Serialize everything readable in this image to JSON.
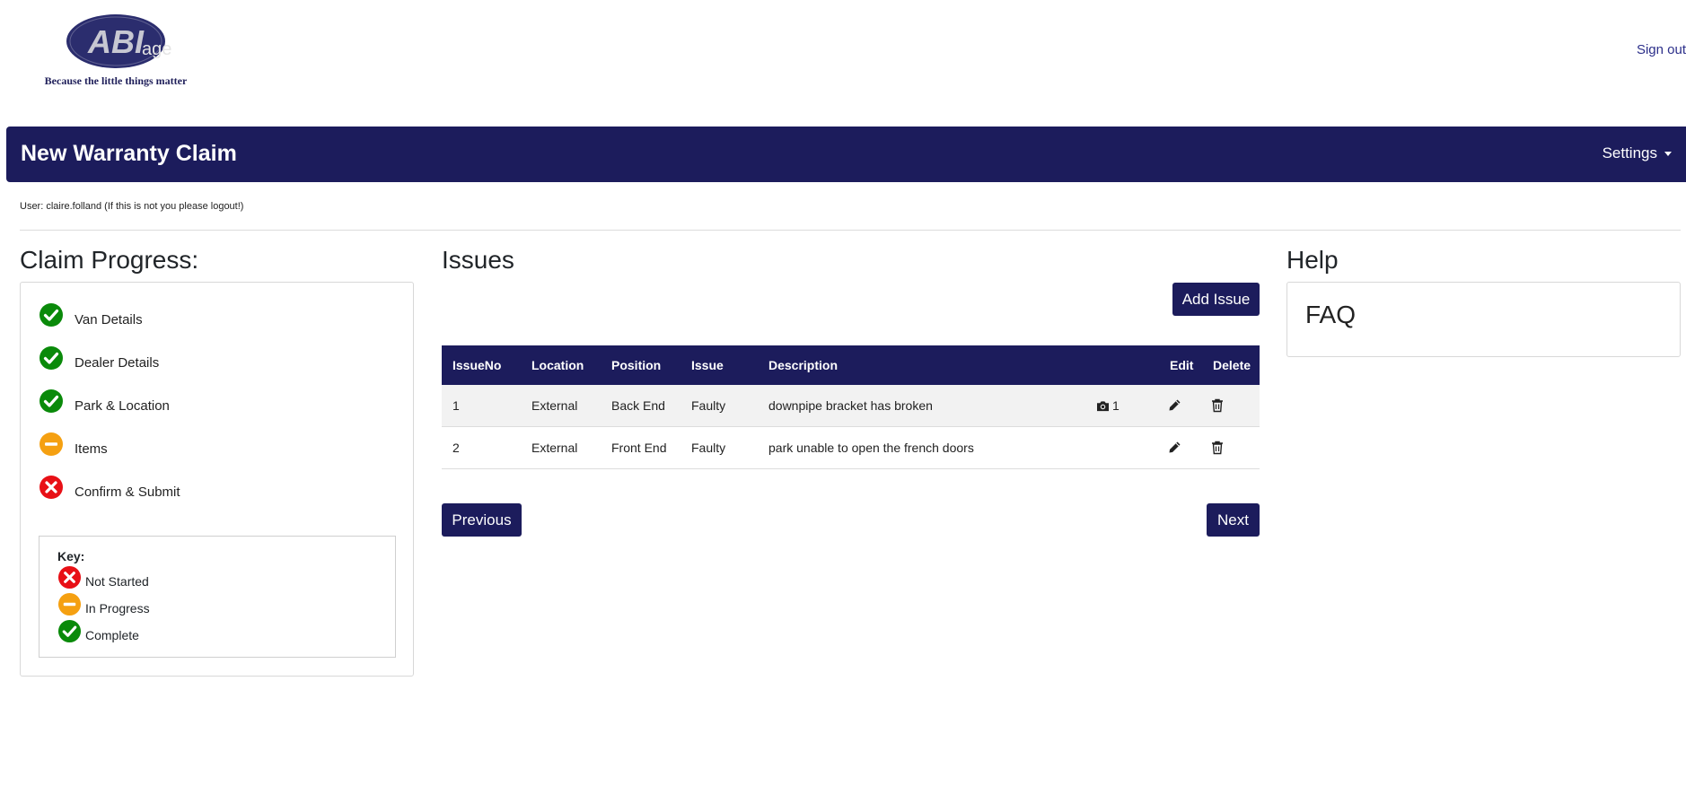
{
  "header": {
    "logo_text": "ABI",
    "tagline": "Because the little things matter",
    "ghost_text": "age",
    "sign_out": "Sign out"
  },
  "navbar": {
    "title": "New Warranty Claim",
    "settings": "Settings"
  },
  "user_line": "User: claire.folland (If this is not you please logout!)",
  "progress": {
    "title": "Claim Progress:",
    "steps": [
      {
        "label": "Van Details",
        "status": "complete"
      },
      {
        "label": "Dealer Details",
        "status": "complete"
      },
      {
        "label": "Park & Location",
        "status": "complete"
      },
      {
        "label": "Items",
        "status": "in-progress"
      },
      {
        "label": "Confirm & Submit",
        "status": "not-started"
      }
    ],
    "key": {
      "title": "Key:",
      "items": [
        {
          "label": "Not Started",
          "status": "not-started"
        },
        {
          "label": "In Progress",
          "status": "in-progress"
        },
        {
          "label": "Complete",
          "status": "complete"
        }
      ]
    }
  },
  "issues": {
    "title": "Issues",
    "add_button": "Add Issue",
    "columns": [
      "IssueNo",
      "Location",
      "Position",
      "Issue",
      "Description",
      "",
      "Edit",
      "Delete"
    ],
    "rows": [
      {
        "no": "1",
        "location": "External",
        "position": "Back End",
        "issue": "Faulty",
        "description": "downpipe bracket has broken",
        "photos": "1"
      },
      {
        "no": "2",
        "location": "External",
        "position": "Front End",
        "issue": "Faulty",
        "description": "park unable to open the french doors",
        "photos": ""
      }
    ],
    "previous": "Previous",
    "next": "Next"
  },
  "help": {
    "title": "Help",
    "faq": "FAQ"
  },
  "colors": {
    "brand": "#1c1c5c",
    "complete": "#0a8a0a",
    "in_progress": "#f5a011",
    "not_started": "#e81016"
  }
}
